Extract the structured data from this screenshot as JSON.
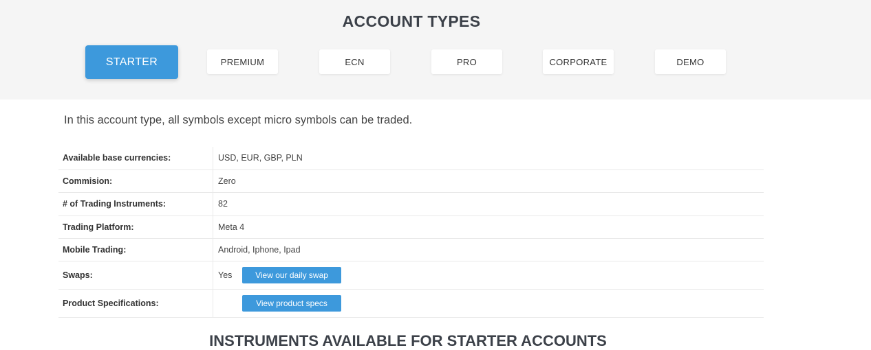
{
  "header": {
    "title": "ACCOUNT TYPES"
  },
  "tabs": [
    {
      "label": "STARTER",
      "active": true
    },
    {
      "label": "PREMIUM",
      "active": false
    },
    {
      "label": "ECN",
      "active": false
    },
    {
      "label": "PRO",
      "active": false
    },
    {
      "label": "CORPORATE",
      "active": false
    },
    {
      "label": "DEMO",
      "active": false
    }
  ],
  "intro": "In this account type, all symbols except micro symbols can be traded.",
  "specs": {
    "rows": [
      {
        "label": "Available base currencies:",
        "value": "USD, EUR, GBP, PLN"
      },
      {
        "label": "Commision:",
        "value": "Zero"
      },
      {
        "label": "# of Trading Instruments:",
        "value": "82"
      },
      {
        "label": "Trading Platform:",
        "value": "Meta 4"
      },
      {
        "label": "Mobile Trading:",
        "value": "Android, Iphone, Ipad"
      },
      {
        "label": "Swaps:",
        "value": "Yes",
        "button": "View our daily swap"
      },
      {
        "label": "Product Specifications:",
        "value": "",
        "button": "View product specs"
      }
    ]
  },
  "next_section": {
    "heading": "INSTRUMENTS AVAILABLE FOR STARTER ACCOUNTS"
  },
  "colors": {
    "accent": "#3d99dc",
    "band": "#f5f5f5",
    "title": "#3c4149"
  }
}
